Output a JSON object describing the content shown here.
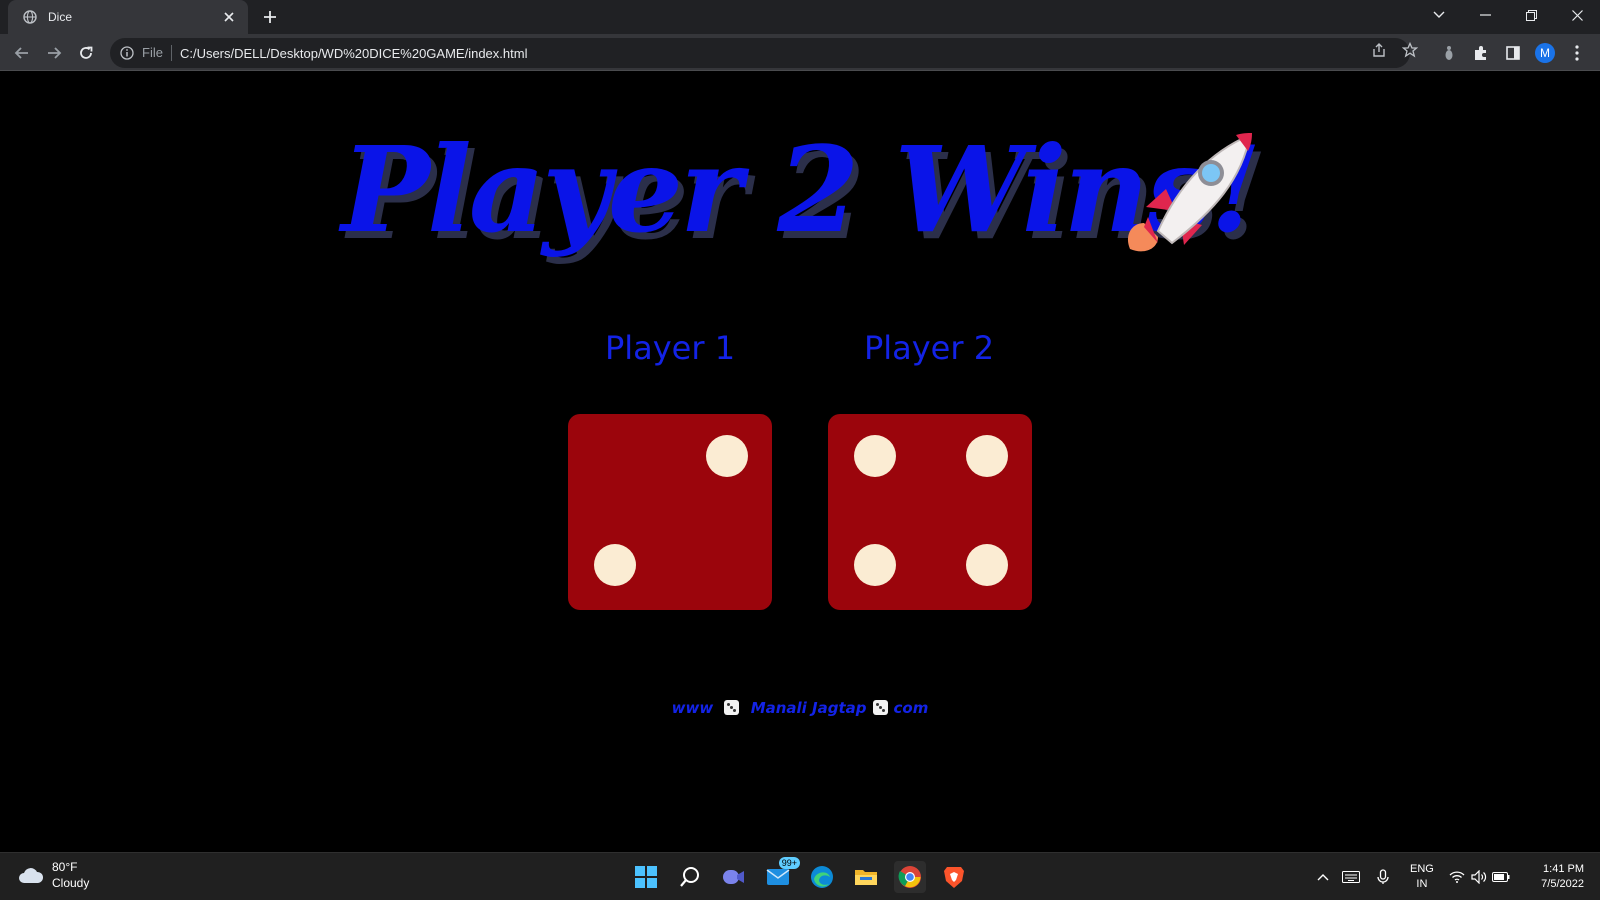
{
  "browser": {
    "tab": {
      "title": "Dice",
      "icon": "globe-icon"
    },
    "address": {
      "scheme": "File",
      "url": "C:/Users/DELL/Desktop/WD%20DICE%20GAME/index.html"
    },
    "profile_initial": "M"
  },
  "page": {
    "headline": "Player 2 Wins!",
    "headline_emoji": "rocket-icon",
    "players": [
      {
        "label": "Player 1",
        "die_value": 2
      },
      {
        "label": "Player 2",
        "die_value": 4
      }
    ],
    "footer": {
      "part1": "www",
      "part2": "Manali Jagtap",
      "part3": "com"
    },
    "colors": {
      "headline": "#0a14e8",
      "die": "#9b050c",
      "pip": "#fbecd3",
      "label": "#1323e6"
    }
  },
  "taskbar": {
    "weather": {
      "temp": "80°F",
      "condition": "Cloudy"
    },
    "mail_badge": "99+",
    "language": {
      "line1": "ENG",
      "line2": "IN"
    },
    "clock": {
      "time": "1:41 PM",
      "date": "7/5/2022"
    }
  }
}
